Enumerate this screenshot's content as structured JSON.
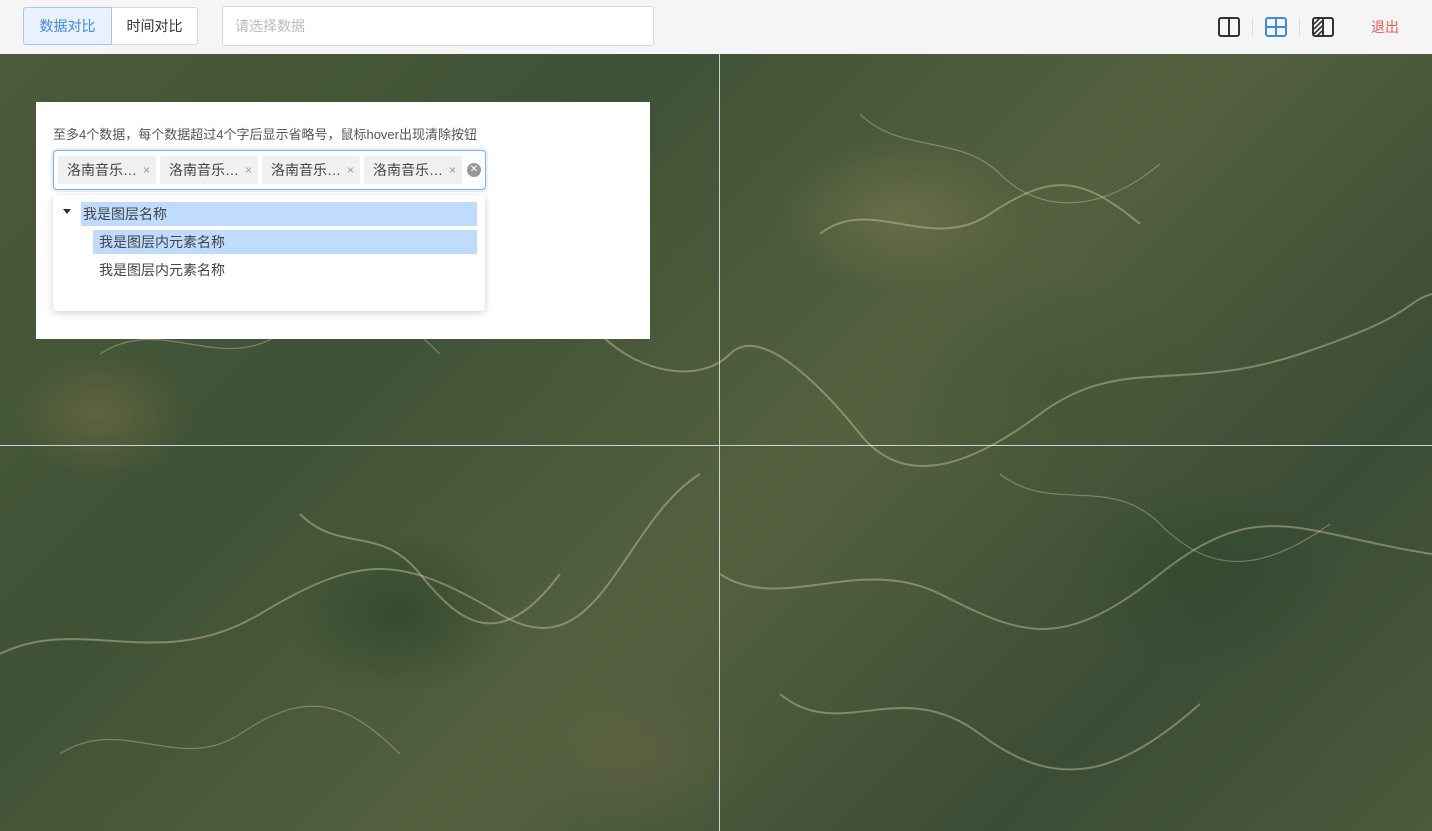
{
  "toolbar": {
    "tabs": [
      "数据对比",
      "时间对比"
    ],
    "active_tab": "数据对比",
    "select_placeholder": "请选择数据",
    "layout_icons": [
      "split-vertical-icon",
      "grid-four-icon",
      "swipe-compare-icon"
    ],
    "active_layout": "grid-four-icon",
    "exit_label": "退出",
    "accent_color": "#3d8ae6",
    "exit_color": "#f05a5a"
  },
  "panel": {
    "hint": "至多4个数据，每个数据超过4个字后显示省略号，鼠标hover出现清除按钮",
    "tags": [
      "洛南音乐…",
      "洛南音乐…",
      "洛南音乐…",
      "洛南音乐…"
    ],
    "tag_close_glyph": "×",
    "clear_icon": "clear-circle-icon"
  },
  "dropdown": {
    "group_label": "我是图层名称",
    "items": [
      "我是图层内元素名称",
      "我是图层内元素名称"
    ],
    "selected_highlight_color": "#bfdbfd"
  }
}
